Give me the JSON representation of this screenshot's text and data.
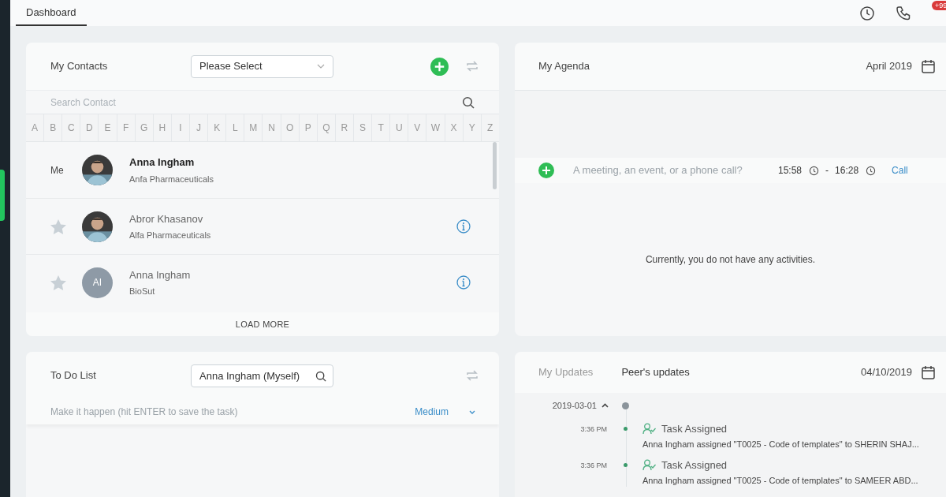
{
  "header": {
    "tabs": [
      {
        "label": "Dashboard",
        "selected": true
      }
    ],
    "badge": "+99"
  },
  "contacts": {
    "title": "My Contacts",
    "select": {
      "placeholder": "Please Select"
    },
    "search": {
      "placeholder": "Search Contact"
    },
    "letters": [
      "A",
      "B",
      "C",
      "D",
      "E",
      "F",
      "G",
      "H",
      "I",
      "J",
      "K",
      "L",
      "M",
      "N",
      "O",
      "P",
      "Q",
      "R",
      "S",
      "T",
      "U",
      "V",
      "W",
      "X",
      "Y",
      "Z"
    ],
    "rows": [
      {
        "kind": "me",
        "label": "Me",
        "name": "Anna Ingham",
        "company": "Anfa Pharmaceuticals"
      },
      {
        "kind": "contact",
        "starred": false,
        "name": "Abror Khasanov",
        "company": "Alfa Pharmaceuticals"
      },
      {
        "kind": "contact",
        "starred": false,
        "name": "Anna Ingham",
        "company": "BioSut",
        "avatar": {
          "kind": "initials",
          "initials": "AI"
        }
      }
    ],
    "load_more": "LOAD MORE"
  },
  "agenda": {
    "title": "My Agenda",
    "month": "April 2019",
    "input": {
      "placeholder": "A meeting, an event, or a phone call?"
    },
    "start": "15:58",
    "separator": "-",
    "end": "16:28",
    "type": "Call",
    "empty": "Currently, you do not have any activities."
  },
  "todo": {
    "title": "To Do List",
    "assignee": "Anna Ingham (Myself)",
    "input": {
      "placeholder": "Make it happen (hit ENTER to save the task)"
    },
    "priority": "Medium"
  },
  "updates": {
    "tabs": [
      {
        "label": "My Updates",
        "selected": false
      },
      {
        "label": "Peer's updates",
        "selected": true
      }
    ],
    "date": "04/10/2019",
    "groups": [
      {
        "date": "2019-03-01",
        "expanded": true,
        "items": [
          {
            "time": "3:36 PM",
            "title": "Task Assigned",
            "text": "Anna Ingham assigned \"T0025 - Code of templates\" to SHERIN SHAJ..."
          },
          {
            "time": "3:36 PM",
            "title": "Task Assigned",
            "text": "Anna Ingham assigned \"T0025 - Code of templates\" to SAMEER ABD..."
          }
        ]
      }
    ]
  }
}
